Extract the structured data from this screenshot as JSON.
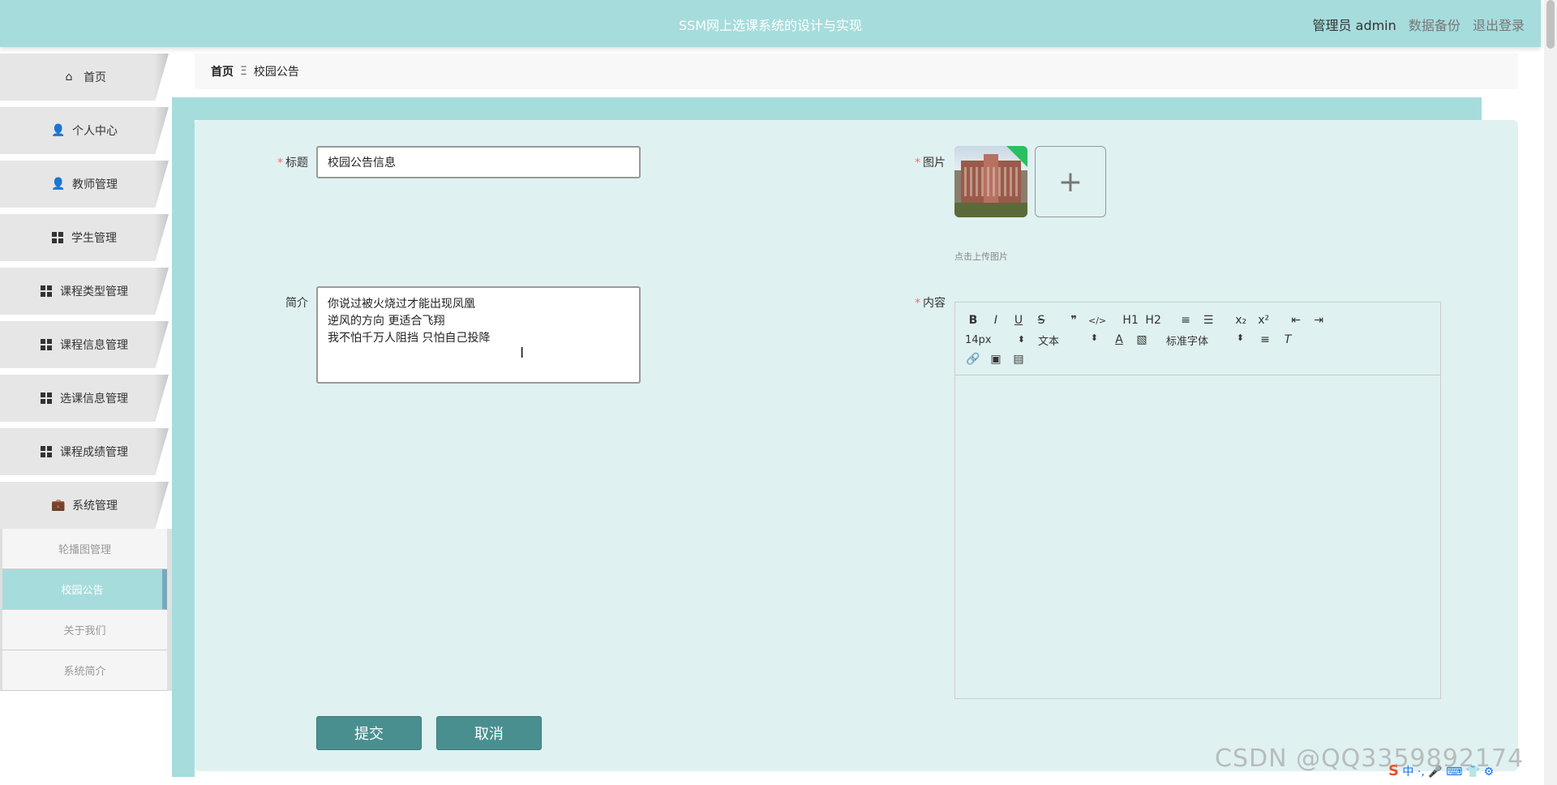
{
  "header": {
    "title": "SSM网上选课系统的设计与实现",
    "user_label": "管理员 admin",
    "backup_link": "数据备份",
    "logout_link": "退出登录",
    "bg_color": "#a6dcdc"
  },
  "sidebar": {
    "items": [
      {
        "label": "首页",
        "icon": "home-icon"
      },
      {
        "label": "个人中心",
        "icon": "user-icon"
      },
      {
        "label": "教师管理",
        "icon": "teacher-icon"
      },
      {
        "label": "学生管理",
        "icon": "grid-icon"
      },
      {
        "label": "课程类型管理",
        "icon": "grid-icon"
      },
      {
        "label": "课程信息管理",
        "icon": "grid-icon"
      },
      {
        "label": "选课信息管理",
        "icon": "grid-icon"
      },
      {
        "label": "课程成绩管理",
        "icon": "grid-icon"
      },
      {
        "label": "系统管理",
        "icon": "briefcase-icon"
      }
    ],
    "sub_items": [
      {
        "label": "轮播图管理",
        "active": false
      },
      {
        "label": "校园公告",
        "active": true
      },
      {
        "label": "关于我们",
        "active": false
      },
      {
        "label": "系统简介",
        "active": false
      }
    ]
  },
  "breadcrumb": {
    "home": "首页",
    "separator": "Ξ",
    "current": "校园公告"
  },
  "form": {
    "title_label": "标题",
    "title_value": "校园公告信息",
    "image_label": "图片",
    "upload_tip": "点击上传图片",
    "intro_label": "简介",
    "intro_value": "你说过被火烧过才能出现凤凰\n逆风的方向  更适合飞翔\n我不怕千万人阻挡  只怕自己投降",
    "content_label": "内容",
    "required_mark": "*",
    "submit_label": "提交",
    "cancel_label": "取消"
  },
  "editor": {
    "toolbar_row1": [
      "B",
      "I",
      "U",
      "S",
      "❞",
      "</>",
      "H1",
      "H2",
      "≡",
      "☰",
      "x₂",
      "x²",
      "⇤",
      "⇥"
    ],
    "font_size": "14px",
    "header_select": "文本",
    "font_family": "标准字体"
  },
  "watermark": "CSDN @QQ3359892174",
  "ime": {
    "logo": "S",
    "text": "中 ·, 🎤 ⌨ 👕 ⚙"
  }
}
